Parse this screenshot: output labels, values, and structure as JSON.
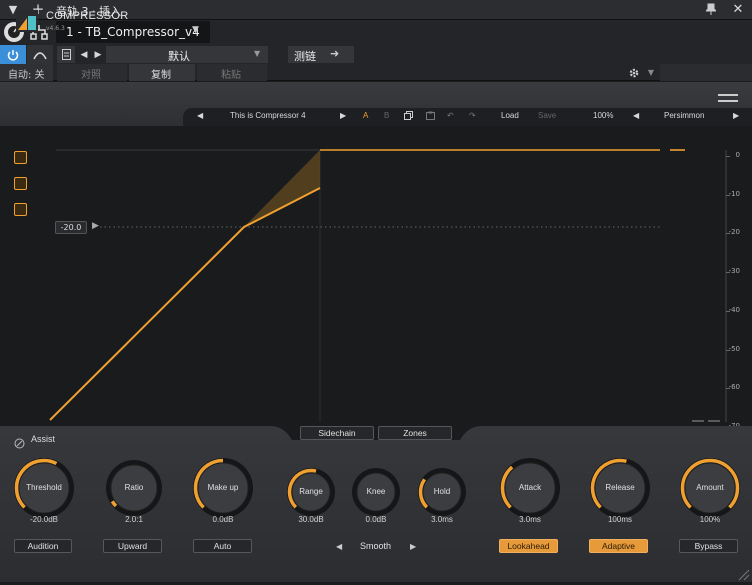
{
  "host": {
    "title": "音轨 3 · 插入",
    "plugin_slot": "1 - TB_Compressor_v4",
    "preset": "默认",
    "sidechain_btn": "测链",
    "auto_label": "自动: 关",
    "compare_label": "对照",
    "copy_label": "复制",
    "paste_label": "粘贴"
  },
  "plugin": {
    "name": "COMPRESSOR",
    "version": "v4.6.3",
    "preset_name": "This is Compressor 4",
    "a_label": "A",
    "b_label": "B",
    "load_label": "Load",
    "save_label": "Save",
    "zoom": "100%",
    "theme": "Persimmon",
    "threshold_tag": "-20.0"
  },
  "meter_scale": [
    "0",
    "-10",
    "-20",
    "-30",
    "-40",
    "-50",
    "-60",
    "-70"
  ],
  "tabs": {
    "sidechain": "Sidechain",
    "zones": "Zones"
  },
  "assist": "Assist",
  "knobs": [
    {
      "label": "Threshold",
      "value": "-20.0dB",
      "level": 0.6
    },
    {
      "label": "Ratio",
      "value": "2.0:1",
      "level": 0.05
    },
    {
      "label": "Make up",
      "value": "0.0dB",
      "level": 0.5
    },
    {
      "label": "Range",
      "value": "30.0dB",
      "level": 0.55
    },
    {
      "label": "Knee",
      "value": "0.0dB",
      "level": 0.0
    },
    {
      "label": "Hold",
      "value": "3.0ms",
      "level": 0.3
    },
    {
      "label": "Attack",
      "value": "3.0ms",
      "level": 0.35
    },
    {
      "label": "Release",
      "value": "100ms",
      "level": 0.55
    },
    {
      "label": "Amount",
      "value": "100%",
      "level": 1.0
    }
  ],
  "buttons": {
    "audition": "Audition",
    "upward": "Upward",
    "auto": "Auto",
    "smooth": "Smooth",
    "lookahead": "Lookahead",
    "adaptive": "Adaptive",
    "bypass": "Bypass"
  },
  "colors": {
    "accent": "#f0a030",
    "background": "#1a1b1d"
  }
}
